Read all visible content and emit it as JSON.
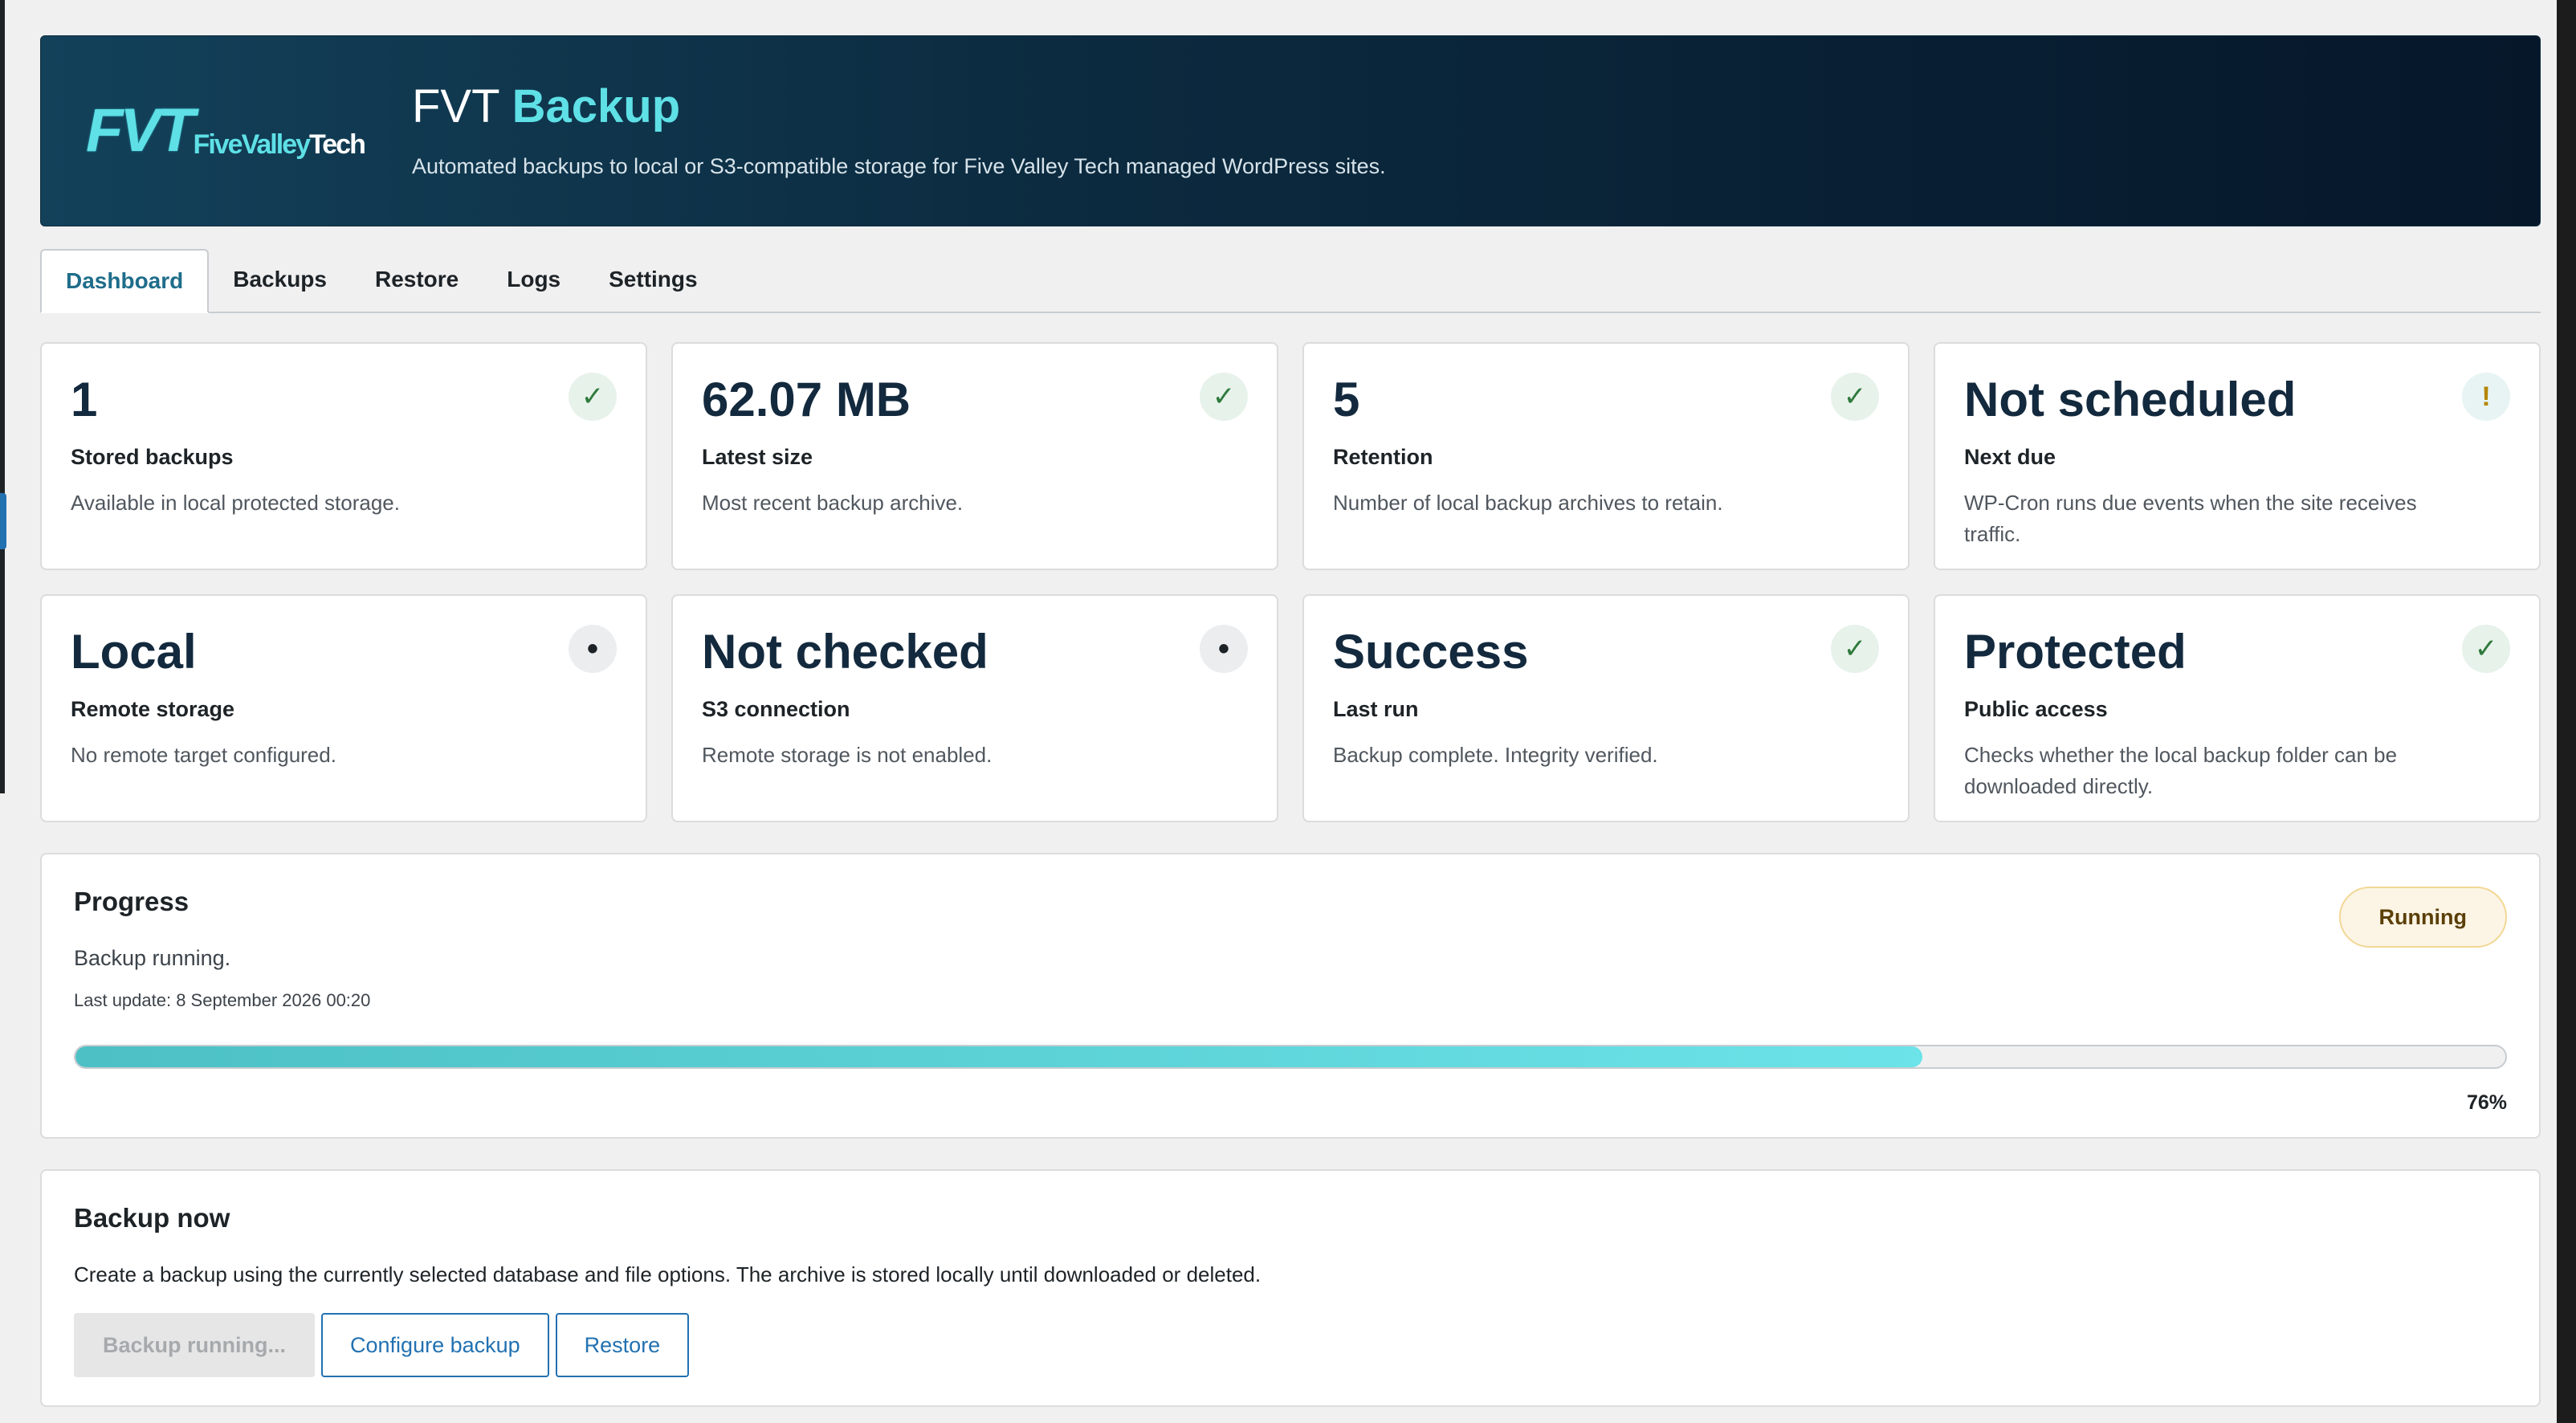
{
  "header": {
    "logo_mark": "FVT",
    "logo_word_a": "Five",
    "logo_word_b": "Valley",
    "logo_word_c": "Tech",
    "title_prefix": "FVT",
    "title_accent": "Backup",
    "subtitle": "Automated backups to local or S3-compatible storage for Five Valley Tech managed WordPress sites."
  },
  "tabs": [
    {
      "label": "Dashboard",
      "active": true
    },
    {
      "label": "Backups"
    },
    {
      "label": "Restore"
    },
    {
      "label": "Logs"
    },
    {
      "label": "Settings"
    }
  ],
  "cards": [
    {
      "value": "1",
      "label": "Stored backups",
      "desc": "Available in local protected storage.",
      "status": "ok",
      "icon": "check-icon",
      "glyph": "✓"
    },
    {
      "value": "62.07 MB",
      "label": "Latest size",
      "desc": "Most recent backup archive.",
      "status": "ok",
      "icon": "check-icon",
      "glyph": "✓"
    },
    {
      "value": "5",
      "label": "Retention",
      "desc": "Number of local backup archives to retain.",
      "status": "ok",
      "icon": "check-icon",
      "glyph": "✓"
    },
    {
      "value": "Not scheduled",
      "label": "Next due",
      "desc": "WP-Cron runs due events when the site receives traffic.",
      "status": "warn",
      "icon": "warning-icon",
      "glyph": "!"
    },
    {
      "value": "Local",
      "label": "Remote storage",
      "desc": "No remote target configured.",
      "status": "neutral",
      "icon": "dot-icon",
      "glyph": "•"
    },
    {
      "value": "Not checked",
      "label": "S3 connection",
      "desc": "Remote storage is not enabled.",
      "status": "neutral",
      "icon": "dot-icon",
      "glyph": "•"
    },
    {
      "value": "Success",
      "label": "Last run",
      "desc": "Backup complete. Integrity verified.",
      "status": "ok",
      "icon": "check-icon",
      "glyph": "✓"
    },
    {
      "value": "Protected",
      "label": "Public access",
      "desc": "Checks whether the local backup folder can be downloaded directly.",
      "status": "ok",
      "icon": "check-icon",
      "glyph": "✓"
    }
  ],
  "progress": {
    "title": "Progress",
    "status": "Running",
    "message": "Backup running.",
    "last_update": "Last update: 8 September 2026 00:20",
    "percent": 76,
    "percent_label": "76%"
  },
  "backup_now": {
    "title": "Backup now",
    "description": "Create a backup using the currently selected database and file options. The archive is stored locally until downloaded or deleted.",
    "buttons": {
      "running": "Backup running...",
      "configure": "Configure backup",
      "restore": "Restore"
    }
  },
  "colors": {
    "accent": "#5ee0e6",
    "ok": "#2f7a3d",
    "warn": "#b58600",
    "link": "#2271b1"
  }
}
